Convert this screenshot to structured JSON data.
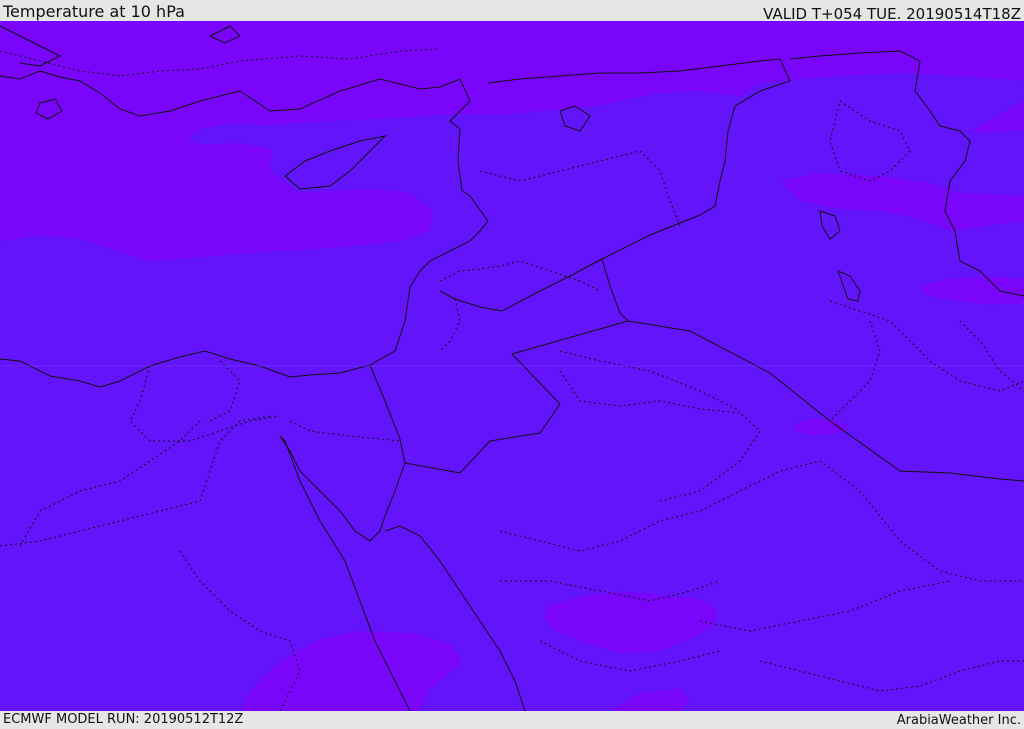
{
  "header": {
    "title": "Temperature at 10 hPa",
    "valid_time": "VALID T+054 TUE. 20190514T18Z"
  },
  "footer": {
    "model_run": "ECMWF MODEL RUN: 20190512T12Z",
    "credit": "ArabiaWeather Inc."
  },
  "colors": {
    "warm_band": "#7a05fb",
    "cool_band": "#6414fb",
    "border_line": "#111111",
    "background": "#e6e6e6"
  }
}
